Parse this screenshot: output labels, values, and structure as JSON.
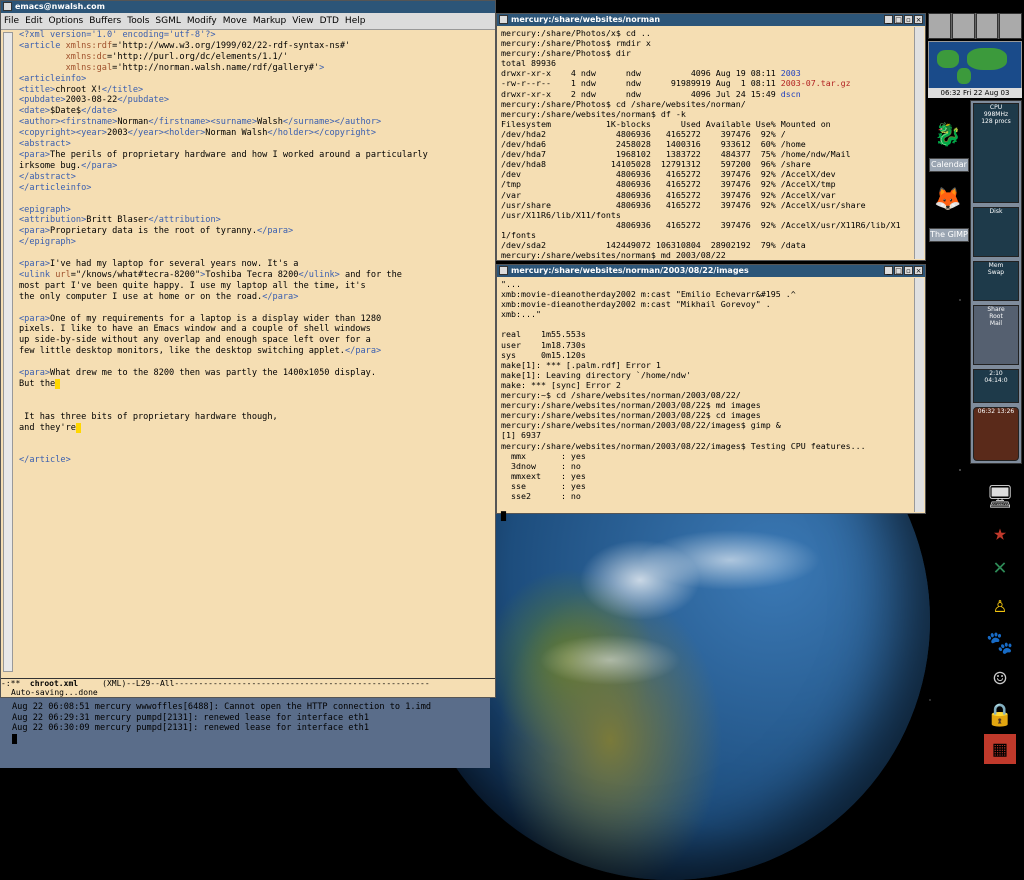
{
  "emacs": {
    "title": "emacs@nwalsh.com",
    "menu": [
      "File",
      "Edit",
      "Options",
      "Buffers",
      "Tools",
      "SGML",
      "Modify",
      "Move",
      "Markup",
      "View",
      "DTD",
      "Help"
    ],
    "modeline_prefix": "-:**",
    "buffer_name": "chroot.xml",
    "modeline_rest": "(XML)--L29--All-----------------------------------------------------",
    "minibuffer": "Auto-saving...done"
  },
  "term1": {
    "title": "mercury:/share/websites/norman"
  },
  "term2": {
    "title": "mercury:/share/websites/norman/2003/08/22/images"
  },
  "xconsole": {
    "lines": [
      "Aug 22 06:08:51 mercury wwwoffles[6488]: Cannot open the HTTP connection to 1.imd",
      "Aug 22 06:29:31 mercury pumpd[2131]: renewed lease for interface eth1",
      "Aug 22 06:30:09 mercury pumpd[2131]: renewed lease for interface eth1"
    ]
  },
  "dock": {
    "clock": "06:32 Fri 22 Aug 03",
    "calendar_label": "Calendar",
    "gimp_label": "The GIMP",
    "cpu_label": "CPU",
    "cpu_freq": "998MHz",
    "procs": "128 procs",
    "disk_label": "Disk",
    "mem_label": "Mem",
    "swap_label": "Swap",
    "menu_items": [
      "Share",
      "Root",
      "Mail"
    ],
    "time_small": "2:10",
    "date_small": "04:14:0",
    "clock_face": "06:32 13:26"
  }
}
